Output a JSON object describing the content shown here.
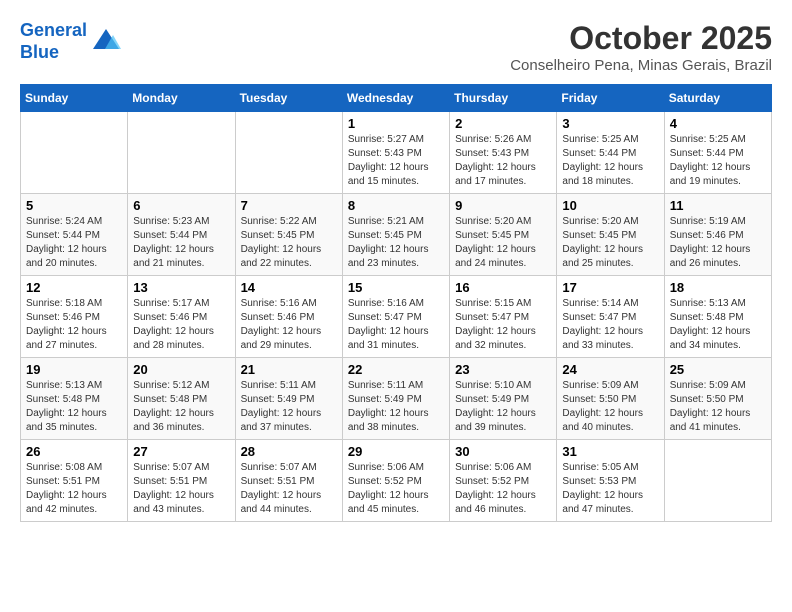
{
  "logo": {
    "line1": "General",
    "line2": "Blue"
  },
  "title": "October 2025",
  "subtitle": "Conselheiro Pena, Minas Gerais, Brazil",
  "days_of_week": [
    "Sunday",
    "Monday",
    "Tuesday",
    "Wednesday",
    "Thursday",
    "Friday",
    "Saturday"
  ],
  "weeks": [
    [
      {
        "day": "",
        "info": ""
      },
      {
        "day": "",
        "info": ""
      },
      {
        "day": "",
        "info": ""
      },
      {
        "day": "1",
        "info": "Sunrise: 5:27 AM\nSunset: 5:43 PM\nDaylight: 12 hours and 15 minutes."
      },
      {
        "day": "2",
        "info": "Sunrise: 5:26 AM\nSunset: 5:43 PM\nDaylight: 12 hours and 17 minutes."
      },
      {
        "day": "3",
        "info": "Sunrise: 5:25 AM\nSunset: 5:44 PM\nDaylight: 12 hours and 18 minutes."
      },
      {
        "day": "4",
        "info": "Sunrise: 5:25 AM\nSunset: 5:44 PM\nDaylight: 12 hours and 19 minutes."
      }
    ],
    [
      {
        "day": "5",
        "info": "Sunrise: 5:24 AM\nSunset: 5:44 PM\nDaylight: 12 hours and 20 minutes."
      },
      {
        "day": "6",
        "info": "Sunrise: 5:23 AM\nSunset: 5:44 PM\nDaylight: 12 hours and 21 minutes."
      },
      {
        "day": "7",
        "info": "Sunrise: 5:22 AM\nSunset: 5:45 PM\nDaylight: 12 hours and 22 minutes."
      },
      {
        "day": "8",
        "info": "Sunrise: 5:21 AM\nSunset: 5:45 PM\nDaylight: 12 hours and 23 minutes."
      },
      {
        "day": "9",
        "info": "Sunrise: 5:20 AM\nSunset: 5:45 PM\nDaylight: 12 hours and 24 minutes."
      },
      {
        "day": "10",
        "info": "Sunrise: 5:20 AM\nSunset: 5:45 PM\nDaylight: 12 hours and 25 minutes."
      },
      {
        "day": "11",
        "info": "Sunrise: 5:19 AM\nSunset: 5:46 PM\nDaylight: 12 hours and 26 minutes."
      }
    ],
    [
      {
        "day": "12",
        "info": "Sunrise: 5:18 AM\nSunset: 5:46 PM\nDaylight: 12 hours and 27 minutes."
      },
      {
        "day": "13",
        "info": "Sunrise: 5:17 AM\nSunset: 5:46 PM\nDaylight: 12 hours and 28 minutes."
      },
      {
        "day": "14",
        "info": "Sunrise: 5:16 AM\nSunset: 5:46 PM\nDaylight: 12 hours and 29 minutes."
      },
      {
        "day": "15",
        "info": "Sunrise: 5:16 AM\nSunset: 5:47 PM\nDaylight: 12 hours and 31 minutes."
      },
      {
        "day": "16",
        "info": "Sunrise: 5:15 AM\nSunset: 5:47 PM\nDaylight: 12 hours and 32 minutes."
      },
      {
        "day": "17",
        "info": "Sunrise: 5:14 AM\nSunset: 5:47 PM\nDaylight: 12 hours and 33 minutes."
      },
      {
        "day": "18",
        "info": "Sunrise: 5:13 AM\nSunset: 5:48 PM\nDaylight: 12 hours and 34 minutes."
      }
    ],
    [
      {
        "day": "19",
        "info": "Sunrise: 5:13 AM\nSunset: 5:48 PM\nDaylight: 12 hours and 35 minutes."
      },
      {
        "day": "20",
        "info": "Sunrise: 5:12 AM\nSunset: 5:48 PM\nDaylight: 12 hours and 36 minutes."
      },
      {
        "day": "21",
        "info": "Sunrise: 5:11 AM\nSunset: 5:49 PM\nDaylight: 12 hours and 37 minutes."
      },
      {
        "day": "22",
        "info": "Sunrise: 5:11 AM\nSunset: 5:49 PM\nDaylight: 12 hours and 38 minutes."
      },
      {
        "day": "23",
        "info": "Sunrise: 5:10 AM\nSunset: 5:49 PM\nDaylight: 12 hours and 39 minutes."
      },
      {
        "day": "24",
        "info": "Sunrise: 5:09 AM\nSunset: 5:50 PM\nDaylight: 12 hours and 40 minutes."
      },
      {
        "day": "25",
        "info": "Sunrise: 5:09 AM\nSunset: 5:50 PM\nDaylight: 12 hours and 41 minutes."
      }
    ],
    [
      {
        "day": "26",
        "info": "Sunrise: 5:08 AM\nSunset: 5:51 PM\nDaylight: 12 hours and 42 minutes."
      },
      {
        "day": "27",
        "info": "Sunrise: 5:07 AM\nSunset: 5:51 PM\nDaylight: 12 hours and 43 minutes."
      },
      {
        "day": "28",
        "info": "Sunrise: 5:07 AM\nSunset: 5:51 PM\nDaylight: 12 hours and 44 minutes."
      },
      {
        "day": "29",
        "info": "Sunrise: 5:06 AM\nSunset: 5:52 PM\nDaylight: 12 hours and 45 minutes."
      },
      {
        "day": "30",
        "info": "Sunrise: 5:06 AM\nSunset: 5:52 PM\nDaylight: 12 hours and 46 minutes."
      },
      {
        "day": "31",
        "info": "Sunrise: 5:05 AM\nSunset: 5:53 PM\nDaylight: 12 hours and 47 minutes."
      },
      {
        "day": "",
        "info": ""
      }
    ]
  ]
}
